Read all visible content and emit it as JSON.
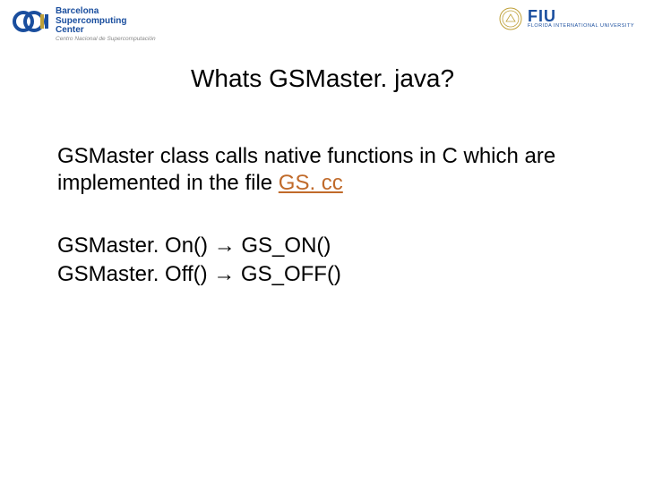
{
  "header": {
    "bsc": {
      "name_line1": "Barcelona",
      "name_line2": "Supercomputing",
      "name_line3": "Center",
      "subtitle": "Centro Nacional de Supercomputación"
    },
    "fiu": {
      "acronym": "FIU",
      "fullname": "FLORIDA INTERNATIONAL UNIVERSITY"
    }
  },
  "title": "Whats GSMaster. java?",
  "body": {
    "para1_a": "GSMaster class calls native functions in C which are implemented in the file ",
    "para1_link": "GS. cc",
    "map1": "GSMaster. On() → GS_ON()",
    "map2": "GSMaster. Off() → GS_OFF()"
  }
}
